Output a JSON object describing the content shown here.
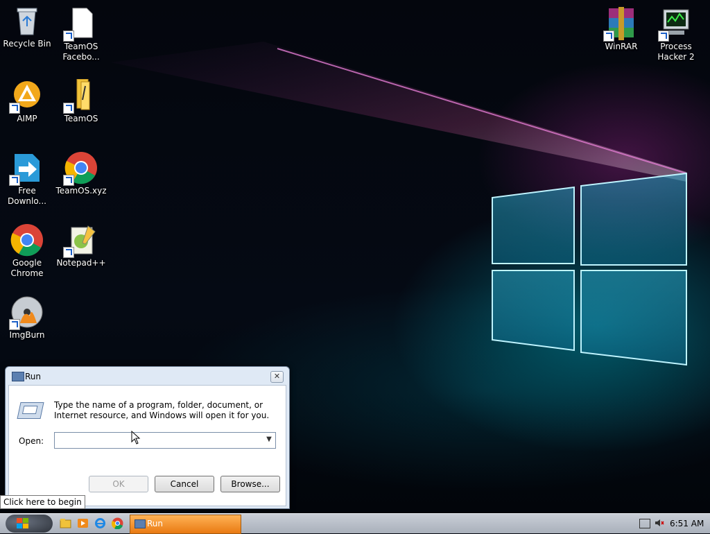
{
  "desktop": {
    "icons": [
      {
        "label": "Recycle Bin",
        "icon": "recycle-bin-icon"
      },
      {
        "label": "TeamOS Facebo...",
        "icon": "document-shortcut-icon"
      },
      {
        "label": "AIMP",
        "icon": "aimp-icon"
      },
      {
        "label": "TeamOS",
        "icon": "folder-icon"
      },
      {
        "label": "Free Downlo...",
        "icon": "free-download-manager-icon"
      },
      {
        "label": "TeamOS.xyz",
        "icon": "chrome-icon"
      },
      {
        "label": "Google Chrome",
        "icon": "chrome-icon"
      },
      {
        "label": "Notepad++",
        "icon": "notepadpp-icon"
      },
      {
        "label": "ImgBurn",
        "icon": "imgburn-icon"
      },
      {
        "label": "WinRAR",
        "icon": "winrar-icon"
      },
      {
        "label": "Process Hacker 2",
        "icon": "process-hacker-icon"
      }
    ]
  },
  "run_dialog": {
    "title": "Run",
    "description": "Type the name of a program, folder, document, or Internet resource, and Windows will open it for you.",
    "open_label": "Open:",
    "open_value": "",
    "ok_label": "OK",
    "cancel_label": "Cancel",
    "browse_label": "Browse..."
  },
  "tooltip": {
    "text": "Click here to begin"
  },
  "taskbar": {
    "running": [
      {
        "label": "Run",
        "icon": "run-icon"
      }
    ],
    "clock": "6:51 AM"
  },
  "colors": {
    "taskbar_active": "#f0902a",
    "dialog_frame": "#dfe9f5"
  }
}
